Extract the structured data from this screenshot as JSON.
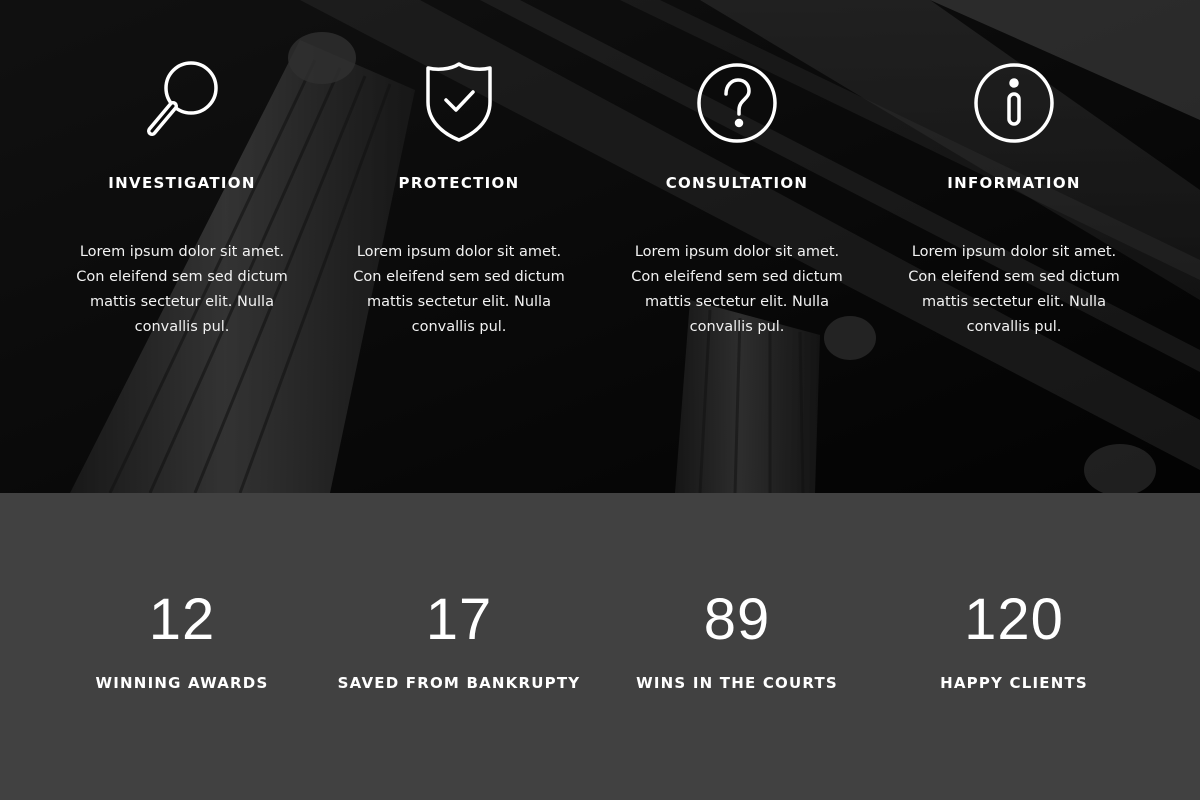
{
  "colors": {
    "hero_background": "#0b0b0b",
    "stats_background": "#414141",
    "text": "#ffffff"
  },
  "services": [
    {
      "icon": "magnifier-icon",
      "title": "INVESTIGATION",
      "text": "Lorem ipsum dolor sit amet. Con eleifend sem sed dictum mattis sectetur elit. Nulla convallis pul."
    },
    {
      "icon": "shield-check-icon",
      "title": "PROTECTION",
      "text": "Lorem ipsum dolor sit amet. Con eleifend sem sed dictum mattis sectetur elit. Nulla convallis pul."
    },
    {
      "icon": "question-circle-icon",
      "title": "CONSULTATION",
      "text": "Lorem ipsum dolor sit amet. Con eleifend sem sed dictum mattis sectetur elit. Nulla convallis pul."
    },
    {
      "icon": "info-circle-icon",
      "title": "INFORMATION",
      "text": "Lorem ipsum dolor sit amet. Con eleifend sem sed dictum mattis sectetur elit. Nulla convallis pul."
    }
  ],
  "stats": [
    {
      "value": "12",
      "label": "WINNING AWARDS"
    },
    {
      "value": "17",
      "label": "SAVED FROM BANKRUPTY"
    },
    {
      "value": "89",
      "label": "WINS IN THE COURTS"
    },
    {
      "value": "120",
      "label": "HAPPY CLIENTS"
    }
  ]
}
